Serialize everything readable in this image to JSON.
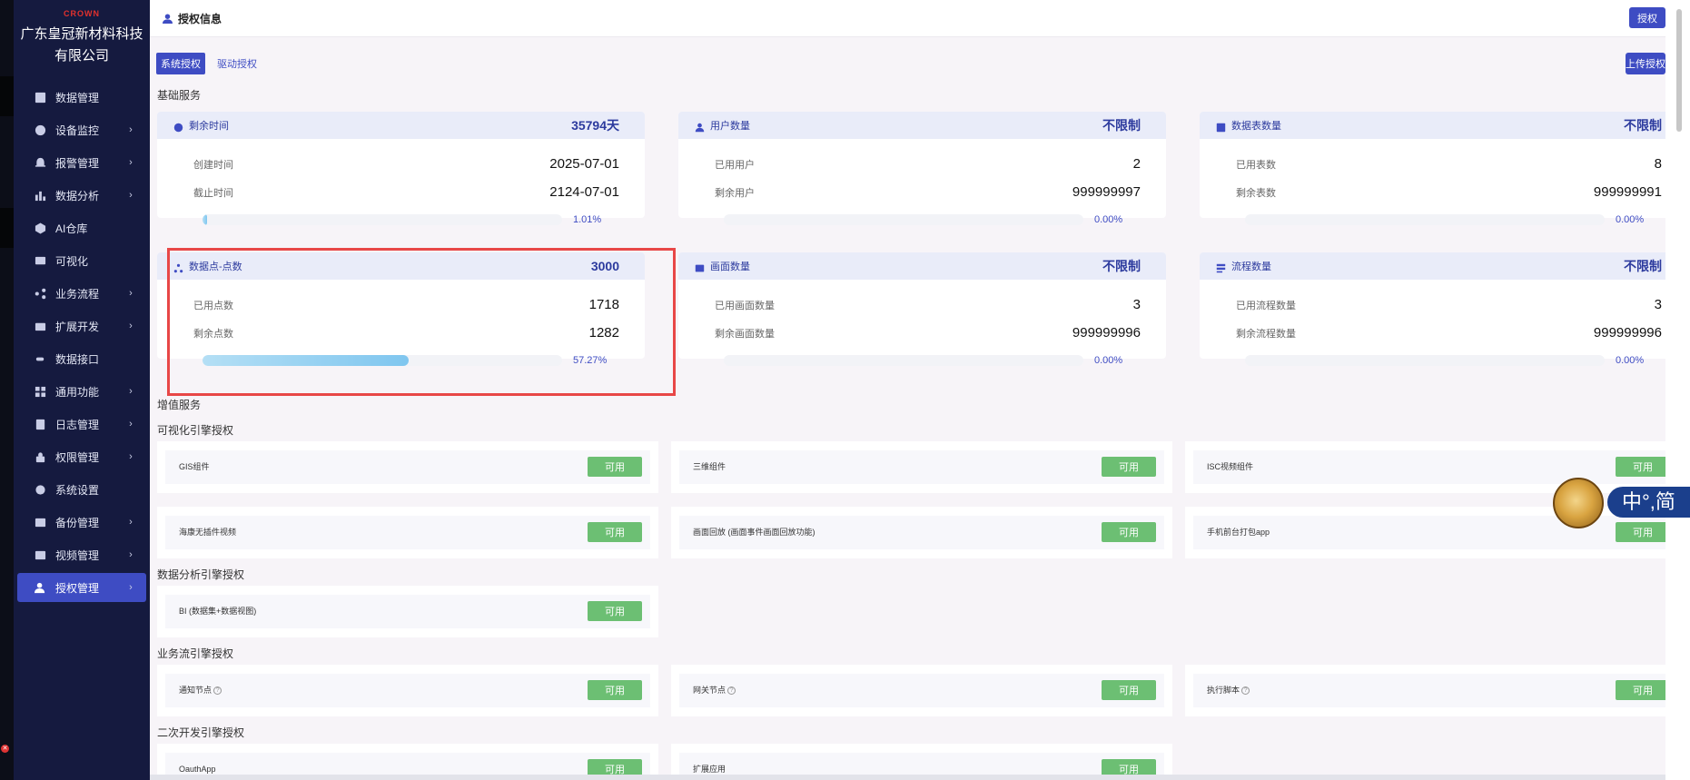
{
  "company": {
    "logo_text": "CROWN",
    "name_line1": "广东皇冠新材料科技",
    "name_line2": "有限公司"
  },
  "sidebar": {
    "items": [
      {
        "label": "数据管理",
        "icon": "chart-board-icon",
        "has_children": false
      },
      {
        "label": "设备监控",
        "icon": "monitor-icon",
        "has_children": true
      },
      {
        "label": "报警管理",
        "icon": "alarm-icon",
        "has_children": true
      },
      {
        "label": "数据分析",
        "icon": "bar-chart-icon",
        "has_children": true
      },
      {
        "label": "AI仓库",
        "icon": "ai-icon",
        "has_children": false
      },
      {
        "label": "可视化",
        "icon": "screen-icon",
        "has_children": false
      },
      {
        "label": "业务流程",
        "icon": "flow-icon",
        "has_children": true
      },
      {
        "label": "扩展开发",
        "icon": "extend-icon",
        "has_children": true
      },
      {
        "label": "数据接口",
        "icon": "plug-icon",
        "has_children": false
      },
      {
        "label": "通用功能",
        "icon": "grid-icon",
        "has_children": true
      },
      {
        "label": "日志管理",
        "icon": "log-icon",
        "has_children": true
      },
      {
        "label": "权限管理",
        "icon": "lock-icon",
        "has_children": true
      },
      {
        "label": "系统设置",
        "icon": "gear-icon",
        "has_children": false
      },
      {
        "label": "备份管理",
        "icon": "backup-icon",
        "has_children": true
      },
      {
        "label": "视频管理",
        "icon": "video-icon",
        "has_children": true
      },
      {
        "label": "授权管理",
        "icon": "user-key-icon",
        "has_children": true,
        "active": true
      }
    ]
  },
  "header": {
    "title": "授权信息",
    "top_button": "授权"
  },
  "tabs": [
    {
      "label": "系统授权",
      "active": true
    },
    {
      "label": "驱动授权",
      "active": false
    }
  ],
  "upload_button": "上传授权",
  "sections": {
    "basic": "基础服务",
    "value_added": "增值服务",
    "visual_engine": "可视化引擎授权",
    "analysis_engine": "数据分析引擎授权",
    "flow_engine": "业务流引擎授权",
    "dev_engine": "二次开发引擎授权"
  },
  "stat_cards": [
    {
      "title": "剩余时间",
      "value": "35794天",
      "row1_label": "创建时间",
      "row1_value": "2025-07-01",
      "row2_label": "截止时间",
      "row2_value": "2124-07-01",
      "progress": 1.01,
      "progress_text": "1.01%",
      "icon": "clock-icon"
    },
    {
      "title": "用户数量",
      "value": "不限制",
      "row1_label": "已用用户",
      "row1_value": "2",
      "row2_label": "剩余用户",
      "row2_value": "999999997",
      "progress": 0.0,
      "progress_text": "0.00%",
      "icon": "user-icon"
    },
    {
      "title": "数据表数量",
      "value": "不限制",
      "row1_label": "已用表数",
      "row1_value": "8",
      "row2_label": "剩余表数",
      "row2_value": "999999991",
      "progress": 0.0,
      "progress_text": "0.00%",
      "icon": "table-icon"
    },
    {
      "title": "数据点-点数",
      "value": "3000",
      "row1_label": "已用点数",
      "row1_value": "1718",
      "row2_label": "剩余点数",
      "row2_value": "1282",
      "progress": 57.27,
      "progress_text": "57.27%",
      "icon": "nodes-icon"
    },
    {
      "title": "画面数量",
      "value": "不限制",
      "row1_label": "已用画面数量",
      "row1_value": "3",
      "row2_label": "剩余画面数量",
      "row2_value": "999999996",
      "progress": 0.0,
      "progress_text": "0.00%",
      "icon": "picture-icon"
    },
    {
      "title": "流程数量",
      "value": "不限制",
      "row1_label": "已用流程数量",
      "row1_value": "3",
      "row2_label": "剩余流程数量",
      "row2_value": "999999996",
      "progress": 0.0,
      "progress_text": "0.00%",
      "icon": "process-icon"
    }
  ],
  "features": {
    "status_label": "可用",
    "visual": [
      "GIS组件",
      "三维组件",
      "ISC视频组件",
      "海康无插件视频",
      "画面回放 (画面事件画面回放功能)",
      "手机前台打包app"
    ],
    "analysis": [
      "BI (数据集+数据视图)"
    ],
    "flow": [
      "通知节点",
      "网关节点",
      "执行脚本"
    ],
    "dev": [
      "OauthApp",
      "扩展应用"
    ]
  },
  "ime": {
    "text": "中°,简"
  },
  "left_strip_mark": "✕",
  "colors": {
    "primary": "#3e4cc3",
    "sidebar_bg": "#151a3f",
    "available_green": "#6cbf73",
    "highlight_red": "#e84747"
  }
}
